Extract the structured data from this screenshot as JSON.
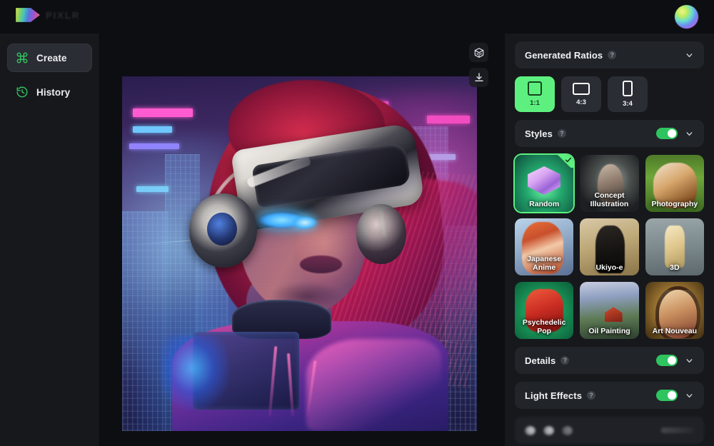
{
  "app": {
    "brand_word": "PIXLR",
    "avatar_icon": "color-sphere-avatar"
  },
  "sidebar": {
    "items": [
      {
        "label": "Create",
        "icon": "command-icon",
        "active": true
      },
      {
        "label": "History",
        "icon": "clock-rewind-icon",
        "active": false
      }
    ]
  },
  "canvas": {
    "tools": [
      {
        "name": "3d-cube-icon",
        "label": "3D"
      },
      {
        "name": "download-icon",
        "label": "Download"
      }
    ],
    "artwork": {
      "alt": "Cyberpunk woman wearing a white VR headset and headphones, red-magenta hair, neon city background",
      "ratio": "1:1"
    }
  },
  "right_panel": {
    "ratios_section": {
      "title": "Generated Ratios",
      "help_icon": "help-icon",
      "chevron": "chevron-down-icon",
      "options": [
        {
          "label": "1:1",
          "selected": true
        },
        {
          "label": "4:3",
          "selected": false
        },
        {
          "label": "3:4",
          "selected": false
        }
      ]
    },
    "styles_section": {
      "title": "Styles",
      "help_icon": "help-icon",
      "chevron": "chevron-down-icon",
      "toggle_on": true,
      "cards": [
        {
          "label": "Random",
          "selected": true
        },
        {
          "label": "Concept Illustration",
          "selected": false
        },
        {
          "label": "Photography",
          "selected": false
        },
        {
          "label": "Japanese Anime",
          "selected": false
        },
        {
          "label": "Ukiyo-e",
          "selected": false
        },
        {
          "label": "3D",
          "selected": false
        },
        {
          "label": "Psychedelic Pop",
          "selected": false
        },
        {
          "label": "Oil Painting",
          "selected": false
        },
        {
          "label": "Art Nouveau",
          "selected": false
        }
      ]
    },
    "details_section": {
      "title": "Details",
      "help_icon": "help-icon",
      "chevron": "chevron-down-icon",
      "toggle_on": true
    },
    "light_effects_section": {
      "title": "Light Effects",
      "help_icon": "help-icon",
      "chevron": "chevron-down-icon",
      "toggle_on": true
    }
  },
  "colors": {
    "accent_green": "#5ef07f",
    "toggle_green": "#2ec45f",
    "icon_green": "#2fbf5d",
    "panel_bg": "#16181c",
    "section_bg": "#212429",
    "canvas_bg": "#0d0e11"
  }
}
